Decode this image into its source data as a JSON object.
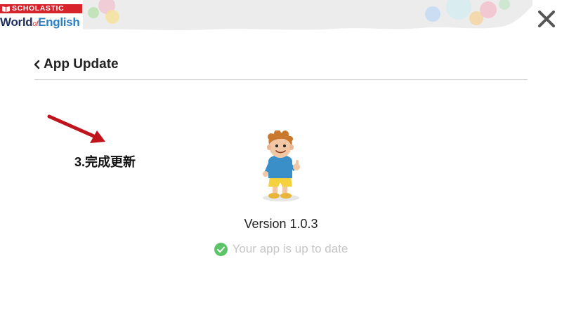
{
  "logo": {
    "top": "SCHOLASTIC",
    "world": "World",
    "of": "of",
    "english": "English",
    "brand_red": "#d8232a",
    "brand_navy": "#20305e"
  },
  "header": {
    "close_icon": "close-icon"
  },
  "nav": {
    "back_icon": "chevron-left-icon",
    "title": "App Update"
  },
  "annotation": {
    "text": "3.完成更新",
    "arrow_color": "#c0141c"
  },
  "content": {
    "version": "Version 1.0.3",
    "status": "Your app is up to date",
    "status_icon": "check-circle-icon",
    "status_color": "#5cc466"
  }
}
